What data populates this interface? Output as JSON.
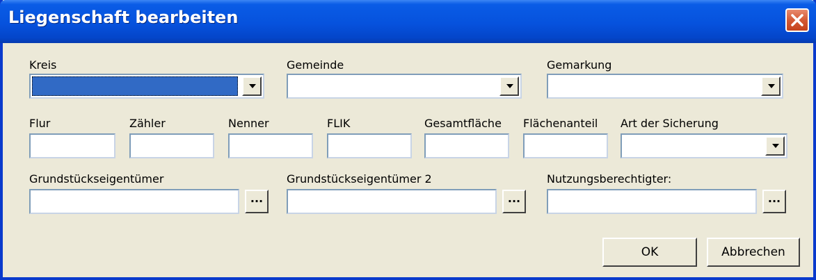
{
  "window": {
    "title": "Liegenschaft bearbeiten"
  },
  "row1": {
    "kreis": {
      "label": "Kreis",
      "value": ""
    },
    "gemeinde": {
      "label": "Gemeinde",
      "value": ""
    },
    "gemarkung": {
      "label": "Gemarkung",
      "value": ""
    }
  },
  "row2": {
    "flur": {
      "label": "Flur",
      "value": ""
    },
    "zaehler": {
      "label": "Zähler",
      "value": ""
    },
    "nenner": {
      "label": "Nenner",
      "value": ""
    },
    "flik": {
      "label": "FLIK",
      "value": ""
    },
    "gesamtflaeche": {
      "label": "Gesamtfläche",
      "value": ""
    },
    "flaechenanteil": {
      "label": "Flächenanteil",
      "value": ""
    },
    "art_der_sicherung": {
      "label": "Art der Sicherung",
      "value": ""
    }
  },
  "row3": {
    "grundstueckseigentuemer": {
      "label": "Grundstückseigentümer",
      "value": "",
      "browse_label": "..."
    },
    "grundstueckseigentuemer2": {
      "label": "Grundstückseigentümer 2",
      "value": "",
      "browse_label": "..."
    },
    "nutzungsberechtigter": {
      "label": "Nutzungsberechtigter:",
      "value": "",
      "browse_label": "..."
    }
  },
  "buttons": {
    "ok": "OK",
    "cancel": "Abbrechen"
  },
  "colors": {
    "titlebar": "#0652DD",
    "dialog_bg": "#ECE9D8",
    "selection": "#316AC5",
    "close_button": "#D45A35"
  }
}
